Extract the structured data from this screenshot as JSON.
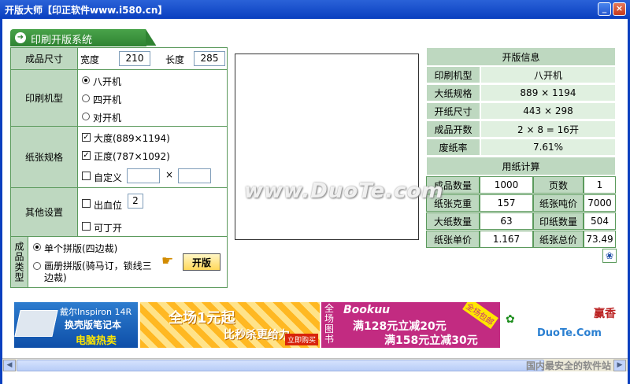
{
  "window": {
    "title": "开版大师【印正软件www.i580.cn】",
    "min_label": "_",
    "close_label": "×"
  },
  "tab": {
    "icon": "arrow-right-icon",
    "label": "印刷开版系统"
  },
  "product_size": {
    "label": "成品尺寸",
    "width_label": "宽度",
    "width_value": "210",
    "length_label": "长度",
    "length_value": "285"
  },
  "press_type": {
    "label": "印刷机型",
    "options": [
      "八开机",
      "四开机",
      "对开机"
    ],
    "selected": "八开机"
  },
  "paper_spec": {
    "label": "纸张规格",
    "option1": "大度(889×1194)",
    "option2": "正度(787×1092)",
    "custom_label": "自定义",
    "times": "×"
  },
  "other": {
    "label": "其他设置",
    "bleed_label": "出血位",
    "bleed_value": "2",
    "ding_label": "可丁开"
  },
  "product_type": {
    "label": "成品类型",
    "option1": "单个拼版(四边裁)",
    "option2": "画册拼版(骑马订，锁线三边裁)"
  },
  "open_button": "开版",
  "layout_info": {
    "title": "开版信息",
    "rows": [
      {
        "label": "印刷机型",
        "value": "八开机"
      },
      {
        "label": "大纸规格",
        "value": "889 × 1194"
      },
      {
        "label": "开纸尺寸",
        "value": "443 × 298"
      },
      {
        "label": "成品开数",
        "value": "2 × 8 = 16开"
      },
      {
        "label": "废纸率",
        "value": "7.61%"
      }
    ]
  },
  "paper_calc": {
    "title": "用纸计算",
    "rows": [
      {
        "l1": "成品数量",
        "v1": "1000",
        "l2": "页数",
        "v2": "1"
      },
      {
        "l1": "纸张克重",
        "v1": "157",
        "l2": "纸张吨价",
        "v2": "7000"
      },
      {
        "l1": "大纸数量",
        "v1": "63",
        "l2": "印纸数量",
        "v2": "504"
      },
      {
        "l1": "纸张单价",
        "v1": "1.167",
        "l2": "纸张总价",
        "v2": "73.49"
      }
    ]
  },
  "ads": {
    "ad1_line1": "戴尔Inspiron 14R",
    "ad1_line2": "换壳版笔记本",
    "ad1_line3": "电脑热卖",
    "ad2_line1": "全场1元起",
    "ad2_line2": "比秒杀更给力",
    "ad2_tag": "立即购买",
    "ad3_brand": "Bookuu",
    "ad3_side": "全场图书",
    "ad3_line1": "满128元立减20元",
    "ad3_line2": "满158元立减30元",
    "ad3_badge": "全场包邮",
    "ad4_text": "赢香"
  },
  "watermark": "www.DuoTe.com",
  "brand": "DuoTe.Com",
  "footer": "国内最安全的软件站",
  "colors": {
    "title_bar": "#0a3fbf",
    "label_bg": "#bed8c0",
    "value_bg": "#e0f0e0",
    "tab_green": "#2f8332"
  }
}
